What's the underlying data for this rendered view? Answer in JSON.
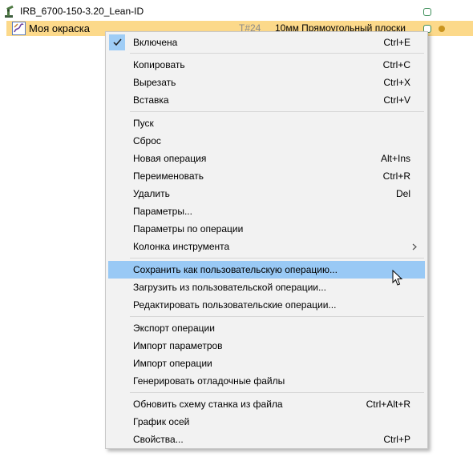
{
  "tree": {
    "robot_label": "IRB_6700-150-3.20_Lean-ID",
    "operation": {
      "label": "Моя окраска",
      "tool_id": "T#24",
      "tool_name": "10мм Прямоугольный плоски"
    },
    "colors": {
      "selected_row": "#fcd98a",
      "status_square": "#3e8f5a",
      "status_dot": "#c9941e"
    }
  },
  "context_menu": {
    "enabled": {
      "label": "Включена",
      "shortcut": "Ctrl+E",
      "checked": true
    },
    "copy": {
      "label": "Копировать",
      "shortcut": "Ctrl+C"
    },
    "cut": {
      "label": "Вырезать",
      "shortcut": "Ctrl+X"
    },
    "paste": {
      "label": "Вставка",
      "shortcut": "Ctrl+V"
    },
    "start": {
      "label": "Пуск"
    },
    "reset": {
      "label": "Сброс"
    },
    "new_operation": {
      "label": "Новая операция",
      "shortcut": "Alt+Ins"
    },
    "rename": {
      "label": "Переименовать",
      "shortcut": "Ctrl+R"
    },
    "delete": {
      "label": "Удалить",
      "shortcut": "Del"
    },
    "parameters": {
      "label": "Параметры..."
    },
    "operation_parameters": {
      "label": "Параметры по операции"
    },
    "tool_column": {
      "label": "Колонка инструмента"
    },
    "save_user_operation": {
      "label": "Сохранить как пользовательскую операцию..."
    },
    "load_user_operation": {
      "label": "Загрузить из пользовательской операции..."
    },
    "edit_user_operations": {
      "label": "Редактировать пользовательские операции..."
    },
    "export_operation": {
      "label": "Экспорт операции"
    },
    "import_parameters": {
      "label": "Импорт параметров"
    },
    "import_operation": {
      "label": "Импорт операции"
    },
    "generate_debug_files": {
      "label": "Генерировать отладочные файлы"
    },
    "update_machine_scheme": {
      "label": "Обновить схему станка из файла",
      "shortcut": "Ctrl+Alt+R"
    },
    "axes_chart": {
      "label": "График осей"
    },
    "properties": {
      "label": "Свойства...",
      "shortcut": "Ctrl+P"
    },
    "colors": {
      "background": "#f2f2f2",
      "highlight": "#99c9f5"
    }
  }
}
